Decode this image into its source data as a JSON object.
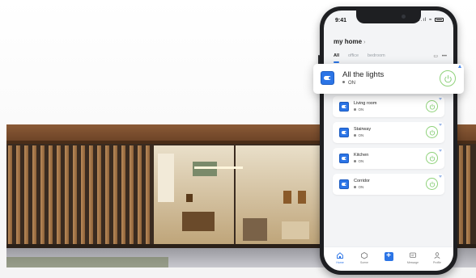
{
  "status_bar": {
    "time": "9:41",
    "signal": "..ıl",
    "wifi": "≈"
  },
  "header": {
    "home_name": "my home",
    "chevron": "›"
  },
  "tabs": [
    {
      "label": "All",
      "active": true
    },
    {
      "label": "office",
      "active": false
    },
    {
      "label": "bedroom",
      "active": false
    }
  ],
  "tab_actions": {
    "grid_icon": "▭",
    "more_icon": "•••"
  },
  "featured_device": {
    "name": "All the lights",
    "status": "ON"
  },
  "devices": [
    {
      "name": "Living room",
      "status": "ON"
    },
    {
      "name": "Stairway",
      "status": "ON"
    },
    {
      "name": "Kitchen",
      "status": "ON"
    },
    {
      "name": "Corridor",
      "status": "ON"
    }
  ],
  "bottom_nav": [
    {
      "label": "Home",
      "icon": "home-icon",
      "active": true
    },
    {
      "label": "Scene",
      "icon": "scene-icon",
      "active": false
    },
    {
      "label": "",
      "icon": "add-icon",
      "active": false
    },
    {
      "label": "Message",
      "icon": "message-icon",
      "active": false
    },
    {
      "label": "Profile",
      "icon": "profile-icon",
      "active": false
    }
  ],
  "colors": {
    "accent": "#2b74e6",
    "power_on": "#7cc96a",
    "screen_bg": "#f3f4f6",
    "phone_body": "#1e1f22"
  }
}
